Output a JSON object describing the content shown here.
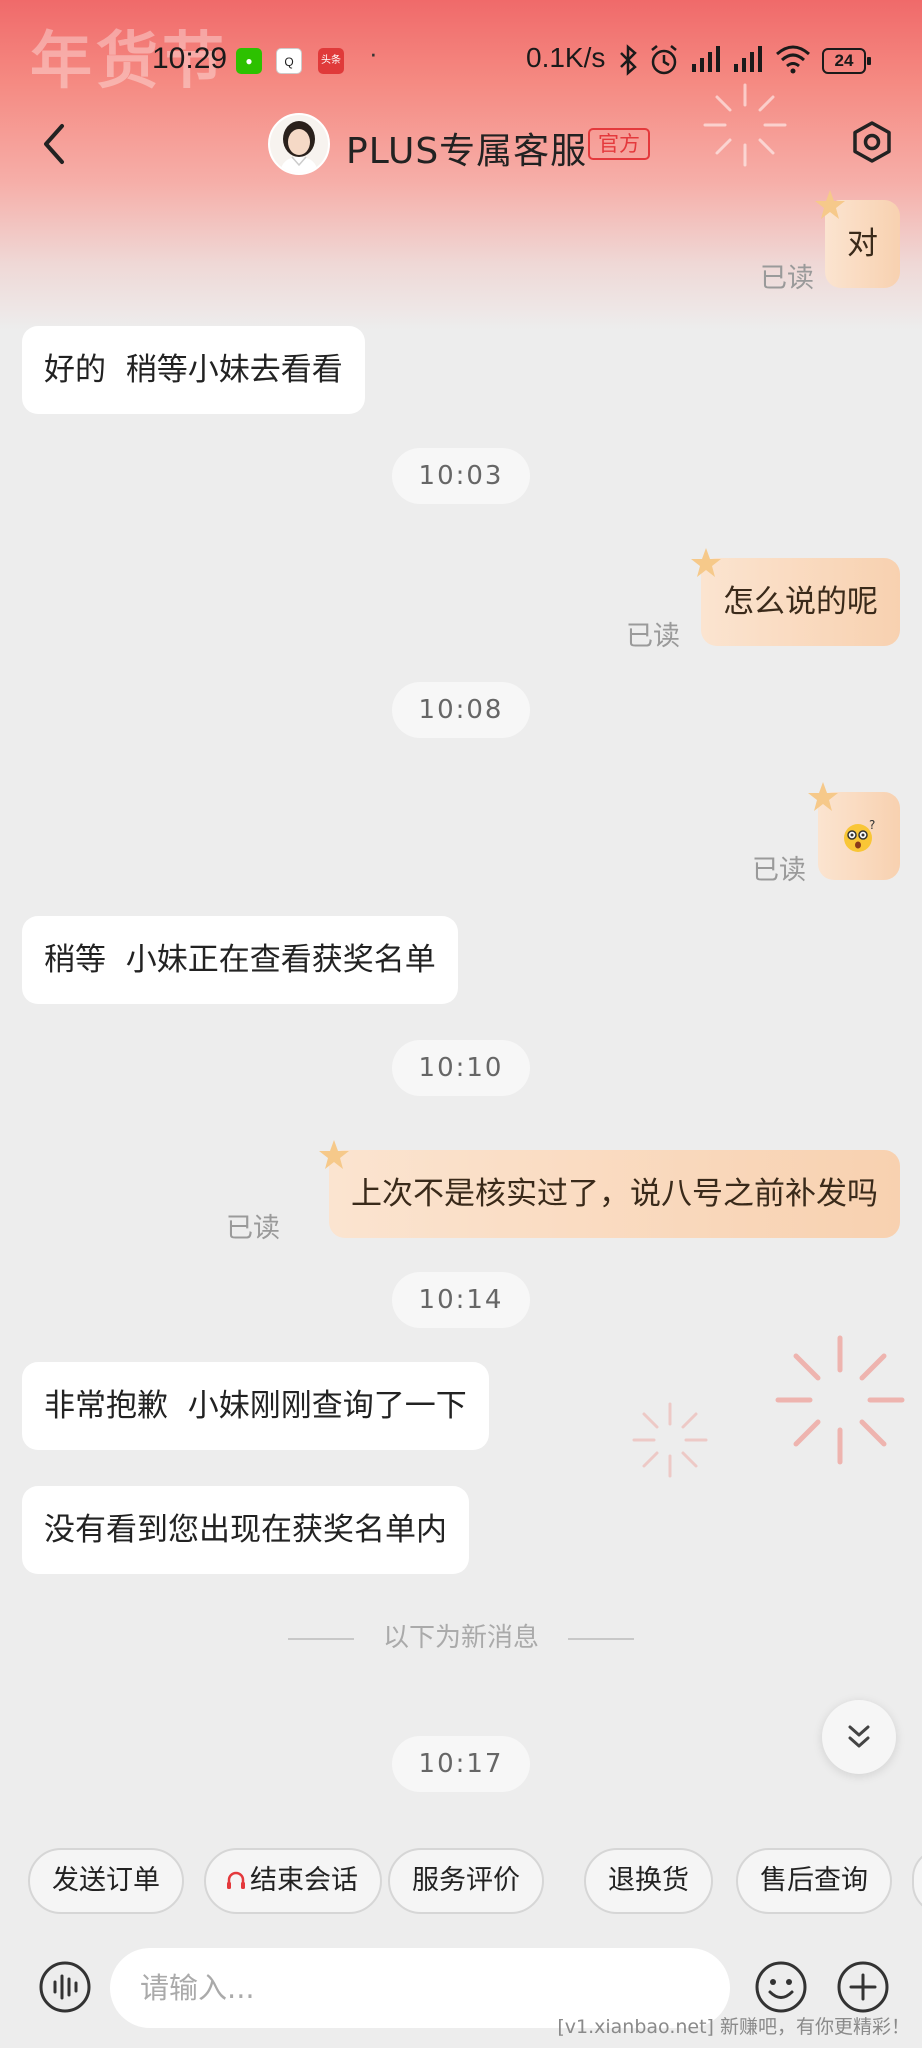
{
  "status_bar": {
    "time": "10:29",
    "net_speed": "0.1K/s",
    "battery": "24",
    "app_icons": [
      "wechat-icon",
      "qq-icon",
      "toutiao-icon"
    ],
    "toutiao_label": "头条"
  },
  "festive_text": "年货节",
  "header": {
    "title": "PLUS专属客服",
    "badge": "官方"
  },
  "messages": [
    {
      "side": "right",
      "text": "对",
      "read": "已读"
    },
    {
      "side": "left",
      "text": "好的  稍等小妹去看看"
    },
    {
      "side": "time",
      "text": "10:03"
    },
    {
      "side": "right",
      "text": "怎么说的呢",
      "read": "已读"
    },
    {
      "side": "time",
      "text": "10:08"
    },
    {
      "side": "right",
      "emoji": "dizzy-face-emoji",
      "read": "已读"
    },
    {
      "side": "left",
      "text": "稍等  小妹正在查看获奖名单"
    },
    {
      "side": "time",
      "text": "10:10"
    },
    {
      "side": "right",
      "text": "上次不是核实过了，说八号之前补发吗",
      "read": "已读"
    },
    {
      "side": "time",
      "text": "10:14"
    },
    {
      "side": "left",
      "text": "非常抱歉  小妹刚刚查询了一下"
    },
    {
      "side": "left",
      "text": "没有看到您出现在获奖名单内"
    },
    {
      "side": "time",
      "text": "10:17"
    }
  ],
  "new_messages_divider": "以下为新消息",
  "quick_replies": [
    "发送订单",
    "结束会话",
    "服务评价",
    "退换货",
    "售后查询"
  ],
  "input": {
    "placeholder": "请输入..."
  },
  "watermark": "[v1.xianbao.net] 新赚吧，有你更精彩！",
  "colors": {
    "accent_red": "#e4393c",
    "user_bubble": "#f8d1b0",
    "agent_bubble": "#ffffff",
    "background": "#ededed"
  }
}
